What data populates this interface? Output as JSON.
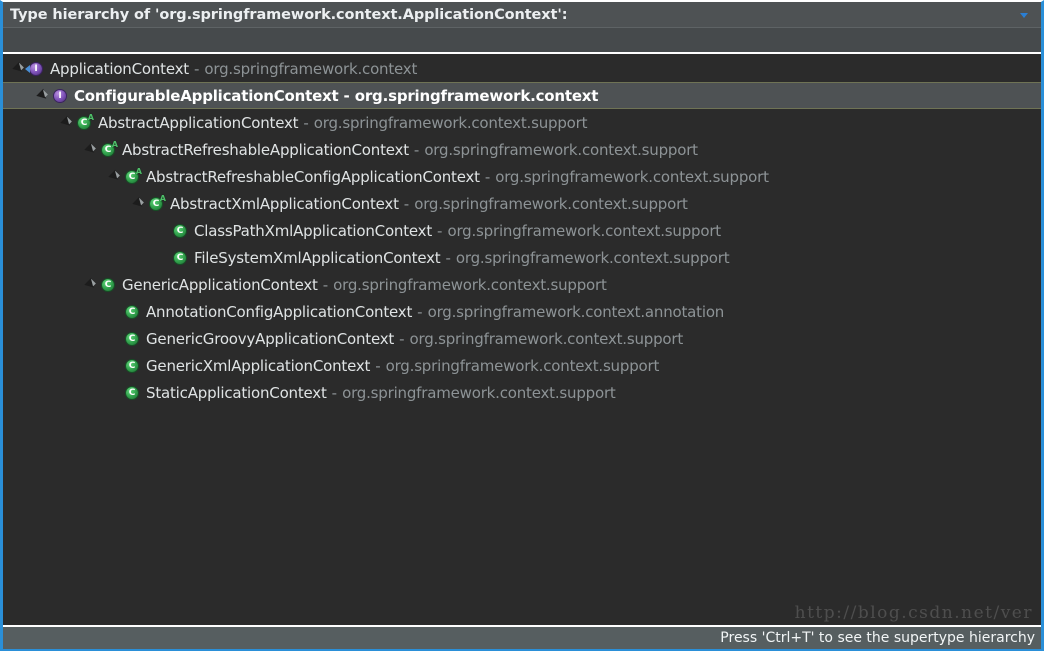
{
  "window": {
    "title": "Type hierarchy of 'org.springframework.context.ApplicationContext':",
    "menu_icon": "chevron-down-icon",
    "accent_color": "#2a8fd8",
    "title_bar_bg": "#4e5254",
    "tree_bg": "#2b2b2b",
    "selection_bg": "#4e5254"
  },
  "tree": {
    "rows": [
      {
        "name": "ApplicationContext",
        "separator": "-",
        "package": "org.springframework.context",
        "icon": "interface-root-icon",
        "kind": "interface",
        "abstract": false,
        "root": true,
        "twisty": "expanded",
        "depth": 0,
        "selected": false
      },
      {
        "name": "ConfigurableApplicationContext",
        "separator": "-",
        "package": "org.springframework.context",
        "icon": "interface-icon",
        "kind": "interface",
        "abstract": false,
        "root": false,
        "twisty": "expanded",
        "depth": 1,
        "selected": true
      },
      {
        "name": "AbstractApplicationContext",
        "separator": "-",
        "package": "org.springframework.context.support",
        "icon": "abstract-class-icon",
        "kind": "class",
        "abstract": true,
        "root": false,
        "twisty": "expanded",
        "depth": 2,
        "selected": false
      },
      {
        "name": "AbstractRefreshableApplicationContext",
        "separator": "-",
        "package": "org.springframework.context.support",
        "icon": "abstract-class-icon",
        "kind": "class",
        "abstract": true,
        "root": false,
        "twisty": "expanded",
        "depth": 3,
        "selected": false
      },
      {
        "name": "AbstractRefreshableConfigApplicationContext",
        "separator": "-",
        "package": "org.springframework.context.support",
        "icon": "abstract-class-icon",
        "kind": "class",
        "abstract": true,
        "root": false,
        "twisty": "expanded",
        "depth": 4,
        "selected": false
      },
      {
        "name": "AbstractXmlApplicationContext",
        "separator": "-",
        "package": "org.springframework.context.support",
        "icon": "abstract-class-icon",
        "kind": "class",
        "abstract": true,
        "root": false,
        "twisty": "expanded",
        "depth": 5,
        "selected": false
      },
      {
        "name": "ClassPathXmlApplicationContext",
        "separator": "-",
        "package": "org.springframework.context.support",
        "icon": "class-icon",
        "kind": "class",
        "abstract": false,
        "root": false,
        "twisty": "none",
        "depth": 6,
        "selected": false
      },
      {
        "name": "FileSystemXmlApplicationContext",
        "separator": "-",
        "package": "org.springframework.context.support",
        "icon": "class-icon",
        "kind": "class",
        "abstract": false,
        "root": false,
        "twisty": "none",
        "depth": 6,
        "selected": false
      },
      {
        "name": "GenericApplicationContext",
        "separator": "-",
        "package": "org.springframework.context.support",
        "icon": "class-icon",
        "kind": "class",
        "abstract": false,
        "root": false,
        "twisty": "expanded",
        "depth": 3,
        "selected": false
      },
      {
        "name": "AnnotationConfigApplicationContext",
        "separator": "-",
        "package": "org.springframework.context.annotation",
        "icon": "class-icon",
        "kind": "class",
        "abstract": false,
        "root": false,
        "twisty": "none",
        "depth": 4,
        "selected": false
      },
      {
        "name": "GenericGroovyApplicationContext",
        "separator": "-",
        "package": "org.springframework.context.support",
        "icon": "class-icon",
        "kind": "class",
        "abstract": false,
        "root": false,
        "twisty": "none",
        "depth": 4,
        "selected": false
      },
      {
        "name": "GenericXmlApplicationContext",
        "separator": "-",
        "package": "org.springframework.context.support",
        "icon": "class-icon",
        "kind": "class",
        "abstract": false,
        "root": false,
        "twisty": "none",
        "depth": 4,
        "selected": false
      },
      {
        "name": "StaticApplicationContext",
        "separator": "-",
        "package": "org.springframework.context.support",
        "icon": "class-icon",
        "kind": "class",
        "abstract": false,
        "root": false,
        "twisty": "none",
        "depth": 4,
        "selected": false
      }
    ]
  },
  "status": {
    "hint": "Press 'Ctrl+T' to see the supertype hierarchy"
  },
  "watermark": {
    "text": "http://blog.csdn.net/ver"
  }
}
